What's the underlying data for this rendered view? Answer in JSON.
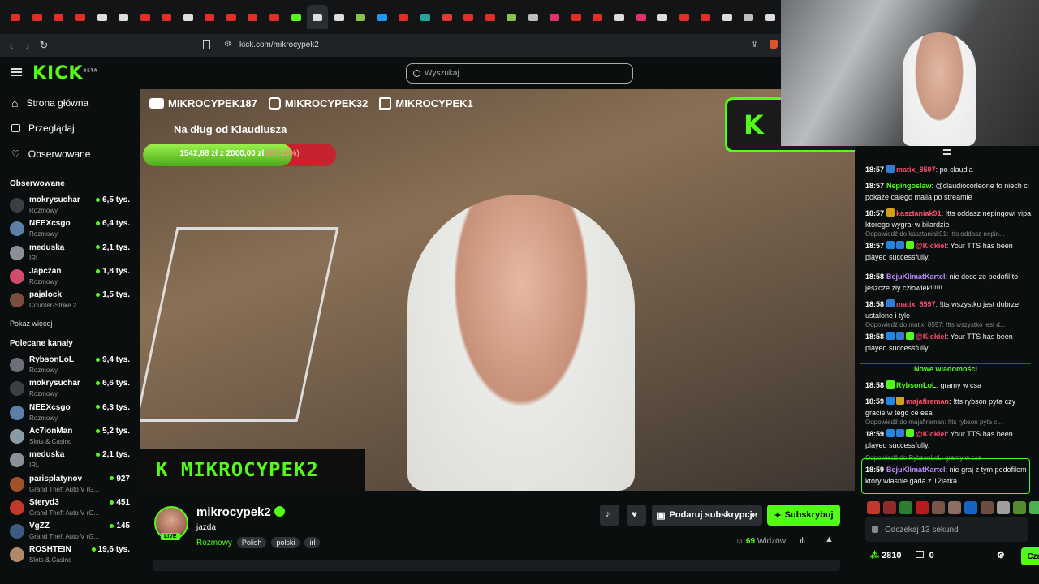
{
  "browser": {
    "tabs": [
      {
        "icon": "youtube-icon",
        "color": "#e52d27"
      },
      {
        "icon": "yt-music-icon",
        "color": "#e52d27"
      },
      {
        "icon": "youtube-icon",
        "color": "#e52d27"
      },
      {
        "icon": "youtube-icon",
        "color": "#e52d27"
      },
      {
        "icon": "x-icon",
        "color": "#dddddd"
      },
      {
        "icon": "tiktok-icon",
        "color": "#dddddd"
      },
      {
        "icon": "youtube-icon",
        "color": "#e52d27"
      },
      {
        "icon": "youtube-icon",
        "color": "#e52d27"
      },
      {
        "icon": "x-icon",
        "color": "#dddddd"
      },
      {
        "icon": "youtube-icon",
        "color": "#e52d27"
      },
      {
        "icon": "youtube-icon",
        "color": "#e52d27"
      },
      {
        "icon": "youtube-icon",
        "color": "#e52d27"
      },
      {
        "icon": "youtube-icon",
        "color": "#e52d27"
      },
      {
        "icon": "kick-icon",
        "color": "#53fc18"
      },
      {
        "icon": "close-icon",
        "color": "#dddddd",
        "active": true
      },
      {
        "icon": "x-icon",
        "color": "#dddddd"
      },
      {
        "icon": "arrow-icon",
        "color": "#8bc34a"
      },
      {
        "icon": "pin-icon",
        "color": "#2196f3"
      },
      {
        "icon": "youtube-icon",
        "color": "#e52d27"
      },
      {
        "icon": "app-icon",
        "color": "#26a69a"
      },
      {
        "icon": "bs-icon",
        "color": "#e53935"
      },
      {
        "icon": "youtube-icon",
        "color": "#e52d27"
      },
      {
        "icon": "youtube-icon",
        "color": "#e52d27"
      },
      {
        "icon": "star-icon",
        "color": "#8bc34a"
      },
      {
        "icon": "globe-icon",
        "color": "#bdbdbd"
      },
      {
        "icon": "instagram-icon",
        "color": "#e1306c"
      },
      {
        "icon": "youtube-icon",
        "color": "#e52d27"
      },
      {
        "icon": "youtube-icon",
        "color": "#e52d27"
      },
      {
        "icon": "x-icon",
        "color": "#dddddd"
      },
      {
        "icon": "instagram-icon",
        "color": "#e1306c"
      },
      {
        "icon": "tiktok-icon",
        "color": "#dddddd"
      },
      {
        "icon": "youtube-icon",
        "color": "#e52d27"
      },
      {
        "icon": "youtube-icon",
        "color": "#e52d27"
      },
      {
        "icon": "x-icon",
        "color": "#dddddd"
      },
      {
        "icon": "globe-icon",
        "color": "#bdbdbd"
      },
      {
        "icon": "discord-icon",
        "color": "#dddddd"
      }
    ],
    "url": "kick.com/mikrocypek2"
  },
  "brand": {
    "logo": "KICK",
    "beta": "BETA",
    "accent": "#53fc18"
  },
  "search": {
    "placeholder": "Wyszukaj"
  },
  "nav": {
    "home": "Strona główna",
    "browse": "Przeglądaj",
    "following": "Obserwowane"
  },
  "followed": {
    "title": "Obserwowane",
    "channels": [
      {
        "name": "mokrysuchar",
        "category": "Rozmowy",
        "viewers": "6,5 tys.",
        "color": "#3a3f44"
      },
      {
        "name": "NEEXcsgo",
        "category": "Rozmowy",
        "viewers": "6,4 tys.",
        "color": "#5b7fa6"
      },
      {
        "name": "meduska",
        "category": "IRL",
        "viewers": "2,1 tys.",
        "color": "#8b8f96"
      },
      {
        "name": "Japczan",
        "category": "Rozmowy",
        "viewers": "1,8 tys.",
        "color": "#d14b6b"
      },
      {
        "name": "pajalock",
        "category": "Counter-Strike 2",
        "viewers": "1,5 tys.",
        "color": "#7a4e3c"
      }
    ],
    "more": "Pokaż więcej"
  },
  "recommended": {
    "title": "Polecane kanały",
    "channels": [
      {
        "name": "RybsonLoL",
        "category": "Rozmowy",
        "viewers": "9,4 tys.",
        "color": "#6b6f7a"
      },
      {
        "name": "mokrysuchar",
        "category": "Rozmowy",
        "viewers": "6,6 tys.",
        "color": "#3a3f44"
      },
      {
        "name": "NEEXcsgo",
        "category": "Rozmowy",
        "viewers": "6,3 tys.",
        "color": "#5b7fa6"
      },
      {
        "name": "Ac7ionMan",
        "category": "Slots & Casino",
        "viewers": "5,2 tys.",
        "color": "#8a9ba8"
      },
      {
        "name": "meduska",
        "category": "IRL",
        "viewers": "2,1 tys.",
        "color": "#8b8f96"
      },
      {
        "name": "parisplatynov",
        "category": "Grand Theft Auto V (G...",
        "viewers": "927",
        "color": "#a0522d"
      },
      {
        "name": "Steryd3",
        "category": "Grand Theft Auto V (G...",
        "viewers": "451",
        "color": "#c0392b"
      },
      {
        "name": "VgZZ",
        "category": "Grand Theft Auto V (G...",
        "viewers": "145",
        "color": "#3d5a80"
      },
      {
        "name": "ROSHTEIN",
        "category": "Slots & Casino",
        "viewers": "19,6 tys.",
        "color": "#b08968"
      }
    ]
  },
  "overlay": {
    "socials": [
      "MIKROCYPEK187",
      "MIKROCYPEK32",
      "MIKROCYPEK1"
    ],
    "goal_title": "Na dług od Klaudiusza",
    "goal_current": "1542,68 zł",
    "goal_sep": "z",
    "goal_target": "2000,00 zł",
    "goal_pct": "(77.13%)",
    "goal_fraction": 0.7713,
    "k_logo": "K",
    "name_banner": "K  MIKROCYPEK2"
  },
  "chat": {
    "messages": [
      {
        "time": "18:57",
        "user": "matix_8597",
        "color": "#ff4d6d",
        "badges": [
          "#2f7dd1"
        ],
        "text": ": po claudia"
      },
      {
        "time": "18:57",
        "user": "Nepingoslaw",
        "color": "#53fc18",
        "badges": [],
        "text": ": @claudiocorleone to niech ci pokaze calego maila po streamie"
      },
      {
        "time": "18:57",
        "user": "kasztaniak91",
        "color": "#ff4d6d",
        "badges": [
          "#d4a017"
        ],
        "text": ": !tts oddasz nepingowi vipa ktorego wygrał w bilardzie"
      },
      {
        "time": "18:57",
        "user": "@Kickiel",
        "color": "#ff4d6d",
        "badges": [
          "#1e88e5",
          "#2f7dd1",
          "#53fc18"
        ],
        "text": ": Your TTS has been played successfully.",
        "reply": "Odpowiedź do kasztaniak91: !tts oddasz nepin..."
      },
      {
        "time": "18:58",
        "user": "BejuKlimatKartel",
        "color": "#c48bff",
        "badges": [],
        "text": ": nie dosc ze pedofil to jeszcze zly człowiek!!!!!!"
      },
      {
        "time": "18:58",
        "user": "matix_8597",
        "color": "#ff4d6d",
        "badges": [
          "#2f7dd1"
        ],
        "text": ": !tts wszystko jest dobrze ustalone i tyle"
      },
      {
        "time": "18:58",
        "user": "@Kickiel",
        "color": "#ff4d6d",
        "badges": [
          "#1e88e5",
          "#2f7dd1",
          "#53fc18"
        ],
        "text": ": Your TTS has been played successfully.",
        "reply": "Odpowiedź do matix_8597: !tts wszystko jest d..."
      },
      {
        "time": "18:58",
        "user": "RybsonLoL",
        "color": "#53fc18",
        "badges": [
          "#53fc18"
        ],
        "text": ": gramy w csa"
      },
      {
        "time": "18:59",
        "user": "majafireman",
        "color": "#ff4d6d",
        "badges": [
          "#1e88e5",
          "#d4a017"
        ],
        "text": ": !tts rybson pyta czy gracie w tego ce esa"
      },
      {
        "time": "18:59",
        "user": "@Kickiel",
        "color": "#ff4d6d",
        "badges": [
          "#1e88e5",
          "#2f7dd1",
          "#53fc18"
        ],
        "text": ": Your TTS has been played successfully.",
        "reply": "Odpowiedź do majafireman: !tts rybson pyta c..."
      },
      {
        "time": "18:59",
        "user": "BejuKlimatKartel",
        "color": "#c48bff",
        "badges": [],
        "text": ": nie graj z tym pedofilem ktory wlasnie gada z 12latka",
        "reply": "Odpowiedź do RybsonLoL: gramy w csa"
      }
    ],
    "new_messages": "Nowe wiadomości",
    "input_placeholder": "Odczekaj 13 sekund",
    "points": "2810",
    "count": "0",
    "send": "Czat",
    "emote_colors": [
      "#c0392b",
      "#8e2c2c",
      "#2e7d32",
      "#b71c1c",
      "#795548",
      "#8d6e63",
      "#1565c0",
      "#6d4c41",
      "#9e9e9e",
      "#558b2f",
      "#4caf50"
    ]
  },
  "streamer": {
    "name": "mikrocypek2",
    "live": "LIVE",
    "title": "jazda",
    "category": "Rozmowy",
    "tags": [
      "Polish",
      "polski",
      "irl"
    ],
    "gift": "Podaruj subskrypcje",
    "subscribe": "Subskrybuj",
    "viewers_count": "69",
    "viewers_label": "Widzów"
  }
}
